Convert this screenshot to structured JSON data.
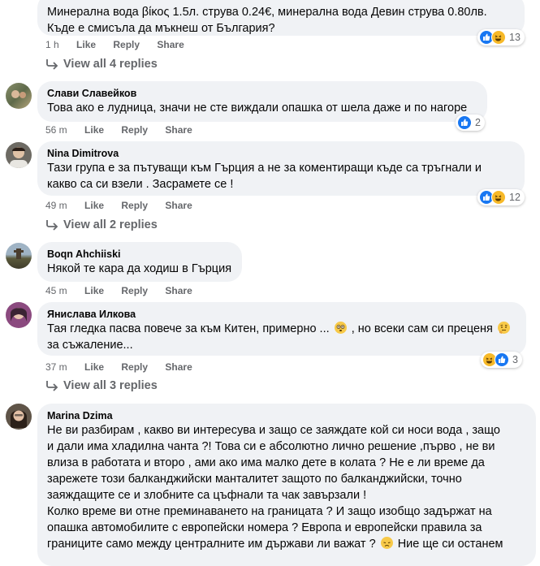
{
  "comments": [
    {
      "author": "",
      "lines": [
        "Минерална вода βίκος 1.5л. струва 0.24€, минерална вода Девин струва 0.80лв.",
        "Къде е смисъла да мъкнеш от България?"
      ],
      "time": "1 h",
      "like": "Like",
      "reply": "Reply",
      "share": "Share",
      "reactions": [
        "like-icon",
        "haha-icon"
      ],
      "reaction_count": "13",
      "view_replies": "View all 4 replies"
    },
    {
      "author": "Слави Славейков",
      "lines": [
        "Това ако е лудница, значи не сте виждали опашка от шела даже и по нагоре"
      ],
      "time": "56 m",
      "like": "Like",
      "reply": "Reply",
      "share": "Share",
      "reactions": [
        "like-icon"
      ],
      "reaction_count": "2"
    },
    {
      "author": "Nina Dimitrova",
      "lines": [
        "Тази група е за пътуващи към Гърция а не за коментиращи къде са тръгнали и",
        "какво са си взели . Засрамете се !"
      ],
      "time": "49 m",
      "like": "Like",
      "reply": "Reply",
      "share": "Share",
      "reactions": [
        "like-icon",
        "haha-icon"
      ],
      "reaction_count": "12",
      "view_replies": "View all 2 replies"
    },
    {
      "author": "Boqn Ahchiiski",
      "lines": [
        "Някой те кара да ходиш в Гърция"
      ],
      "time": "45 m",
      "like": "Like",
      "reply": "Reply",
      "share": "Share"
    },
    {
      "author": "Янислава Илкова",
      "line1_a": "Тая гледка пасва повече за към Китен, примерно ...",
      "line1_b": ", но всеки сам си преценя",
      "line2": "за съжаление...",
      "time": "37 m",
      "like": "Like",
      "reply": "Reply",
      "share": "Share",
      "reactions": [
        "haha-icon",
        "like-icon"
      ],
      "reaction_count": "3",
      "view_replies": "View all 3 replies"
    },
    {
      "author": "Marina Dzima",
      "lines": [
        "Не ви разбирам , какво ви интересува и защо се заяждате кой си носи вода , защо",
        "и дали има хладилна чанта ?! Това си е абсолютно лично решение ,първо , не ви",
        "влиза в работата и второ , ами ако има малко дете в колата ? Не е ли време да",
        "зарежете този балканджийски манталитет защото по балканджийски, точно",
        "заяждащите се и злобните са цъфнали та чак завързали !",
        "Колко време ви отне преминаването на границата ? И защо изобщо задържат на",
        "опашка автомобилите с европейски номера ? Европа и европейски правила за",
        "границите само между централните им държави ли важат ?"
      ],
      "last_tail": "Ние ще си останем"
    }
  ]
}
